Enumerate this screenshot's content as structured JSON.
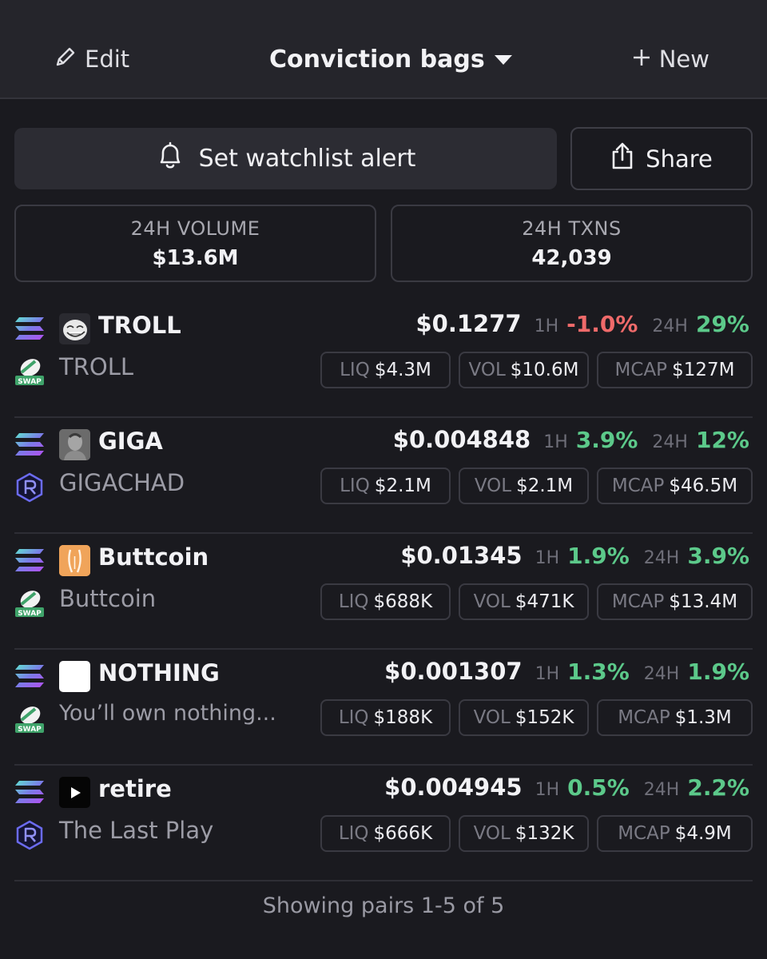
{
  "header": {
    "edit_label": "Edit",
    "title": "Conviction bags",
    "new_label": "New"
  },
  "actions": {
    "alert_label": "Set watchlist alert",
    "share_label": "Share"
  },
  "stats": {
    "volume_label": "24H VOLUME",
    "volume_value": "$13.6M",
    "txns_label": "24H TXNS",
    "txns_value": "42,039"
  },
  "labels": {
    "h1": "1H",
    "h24": "24H",
    "liq": "LIQ",
    "vol": "VOL",
    "mcap": "MCAP"
  },
  "pairs": [
    {
      "symbol": "TROLL",
      "name": "TROLL",
      "price": "$0.1277",
      "chg1h": "-1.0%",
      "chg24h": "29%",
      "liq": "$4.3M",
      "vol": "$10.6M",
      "mcap": "$127M",
      "icon": "troll-face-icon",
      "dex": "swap-icon"
    },
    {
      "symbol": "GIGA",
      "name": "GIGACHAD",
      "price": "$0.004848",
      "chg1h": "3.9%",
      "chg24h": "12%",
      "liq": "$2.1M",
      "vol": "$2.1M",
      "mcap": "$46.5M",
      "icon": "gigachad-photo-icon",
      "dex": "raydium-icon"
    },
    {
      "symbol": "Buttcoin",
      "name": "Buttcoin",
      "price": "$0.01345",
      "chg1h": "1.9%",
      "chg24h": "3.9%",
      "liq": "$688K",
      "vol": "$471K",
      "mcap": "$13.4M",
      "icon": "buttcoin-icon",
      "dex": "swap-icon"
    },
    {
      "symbol": "NOTHING",
      "name": "You’ll own nothing...",
      "price": "$0.001307",
      "chg1h": "1.3%",
      "chg24h": "1.9%",
      "liq": "$188K",
      "vol": "$152K",
      "mcap": "$1.3M",
      "icon": "blank-white-icon",
      "dex": "swap-icon"
    },
    {
      "symbol": "retire",
      "name": "The Last Play",
      "price": "$0.004945",
      "chg1h": "0.5%",
      "chg24h": "2.2%",
      "liq": "$666K",
      "vol": "$132K",
      "mcap": "$4.9M",
      "icon": "play-icon",
      "dex": "raydium-icon"
    }
  ],
  "footer": {
    "text": "Showing pairs 1-5 of 5"
  },
  "colors": {
    "positive": "#5cc98a",
    "negative": "#ef6a6a",
    "background": "#1a1a1f"
  }
}
